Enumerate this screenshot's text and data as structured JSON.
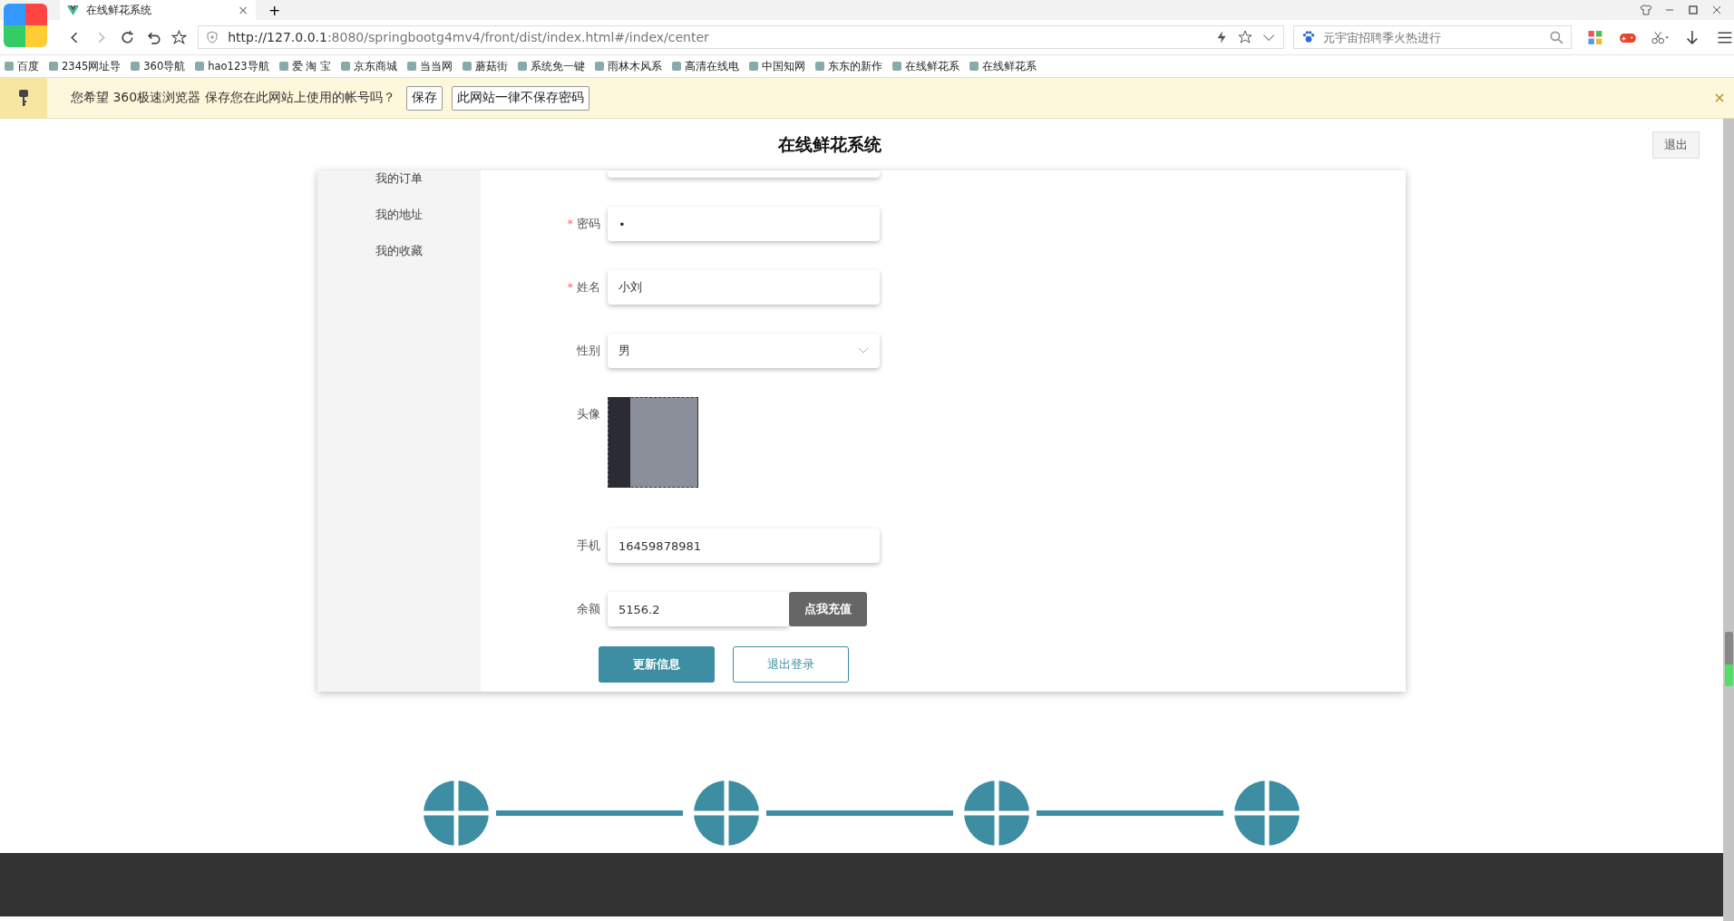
{
  "browser": {
    "tab": {
      "title": "在线鲜花系统",
      "close": "×"
    },
    "new_tab": "+",
    "address": {
      "host": "http://127.0.0.1",
      "rest": ":8080/springbootg4mv4/front/dist/index.html#/index/center"
    },
    "search": {
      "placeholder": "元宇宙招聘季火热进行"
    },
    "bookmarks": [
      "百度",
      "2345网址导",
      "360导航",
      "hao123导航",
      "爱 淘 宝",
      "京东商城",
      "当当网",
      "蘑菇街",
      "系统免一键",
      "雨林木风系",
      "高清在线电",
      "中国知网",
      "东东的新作",
      "在线鲜花系",
      "在线鲜花系"
    ],
    "password_bar": {
      "message": "您希望 360极速浏览器 保存您在此网站上使用的帐号吗？",
      "buttons": [
        "保存",
        "此网站一律不保存密码"
      ]
    }
  },
  "header": {
    "title": "在线鲜花系统",
    "logout": "退出"
  },
  "sidebar": {
    "items": [
      "我的订单",
      "我的地址",
      "我的收藏"
    ]
  },
  "form": {
    "fields": [
      {
        "kind": "text",
        "label": "密码",
        "required_mark": "*",
        "value": "•"
      },
      {
        "kind": "text",
        "label": "姓名",
        "required_mark": "*",
        "value": "小刘"
      },
      {
        "kind": "select",
        "label": "性别",
        "value": "男"
      },
      {
        "kind": "image",
        "label": "头像"
      },
      {
        "kind": "text",
        "label": "手机",
        "value": "16459878981"
      },
      {
        "kind": "balance",
        "label": "余额",
        "value": "5156.2",
        "action": "点我充值"
      }
    ],
    "buttons": [
      {
        "kind": "primary",
        "label": "更新信息"
      },
      {
        "kind": "plain",
        "label": "退出登录"
      }
    ]
  }
}
